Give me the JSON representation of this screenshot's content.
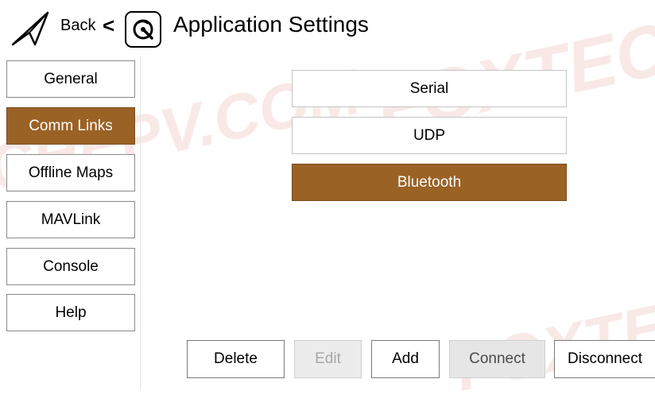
{
  "header": {
    "back_label": "Back",
    "chevron": "<",
    "title": "Application Settings"
  },
  "sidebar": {
    "items": [
      {
        "label": "General",
        "active": false
      },
      {
        "label": "Comm Links",
        "active": true
      },
      {
        "label": "Offline Maps",
        "active": false
      },
      {
        "label": "MAVLink",
        "active": false
      },
      {
        "label": "Console",
        "active": false
      },
      {
        "label": "Help",
        "active": false
      }
    ]
  },
  "links": {
    "items": [
      {
        "label": "Serial",
        "selected": false
      },
      {
        "label": "UDP",
        "selected": false
      },
      {
        "label": "Bluetooth",
        "selected": true
      }
    ]
  },
  "actions": {
    "delete": "Delete",
    "edit": "Edit",
    "add": "Add",
    "connect": "Connect",
    "disconnect": "Disconnect"
  },
  "watermark": {
    "text_a": "CHEPV.COM",
    "text_b": "FOXTECH"
  },
  "colors": {
    "accent": "#9b6226",
    "watermark": "#f3d8d4"
  }
}
